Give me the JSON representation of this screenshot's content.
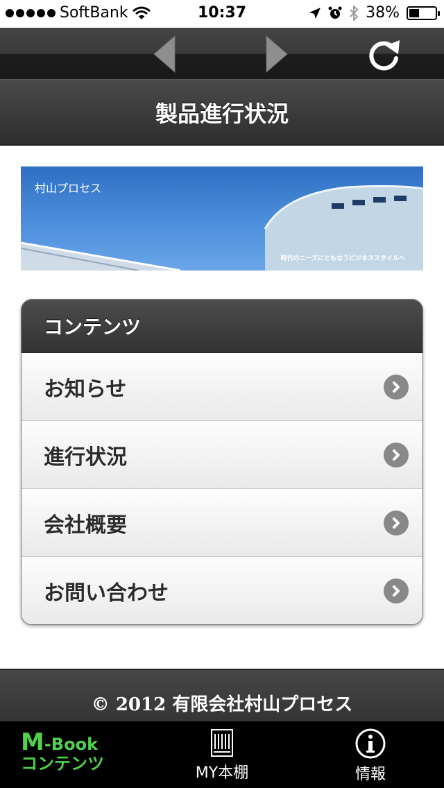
{
  "status_bar": {
    "carrier": "SoftBank",
    "time": "10:37",
    "battery_percent": "38%",
    "battery_level": 0.38,
    "signal_dots": 5,
    "icons": [
      "wifi-icon",
      "location-arrow-icon",
      "alarm-icon",
      "bluetooth-icon",
      "battery-icon"
    ]
  },
  "toolbar": {
    "buttons": [
      "back-arrow-icon",
      "forward-arrow-icon",
      "reload-icon"
    ]
  },
  "page": {
    "title": "製品進行状況"
  },
  "banner": {
    "company": "村山プロセス",
    "tagline": "時代のニーズにともなうビジネススタイルへ"
  },
  "contents": {
    "header": "コンテンツ",
    "items": [
      {
        "label": "お知らせ"
      },
      {
        "label": "進行状況"
      },
      {
        "label": "会社概要"
      },
      {
        "label": "お問い合わせ"
      }
    ]
  },
  "footer": {
    "copyright": "© 2012 有限会社村山プロセス"
  },
  "tabbar": {
    "mbook_line1_big": "M",
    "mbook_line1_rest": "-Book",
    "mbook_line2": "コンテンツ",
    "shelf_label": "MY本棚",
    "info_label": "情報"
  },
  "colors": {
    "brand_green": "#4fd24a",
    "header_dark": "#333333",
    "banner_blue": "#4d8fdc"
  }
}
